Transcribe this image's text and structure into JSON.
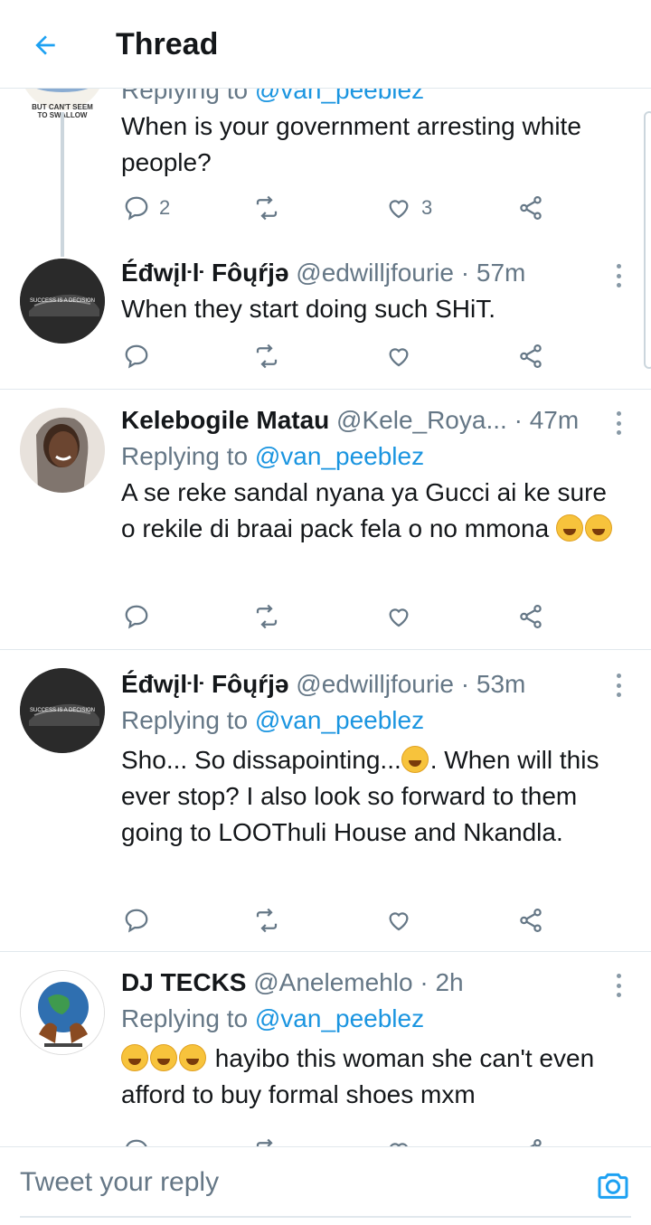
{
  "header": {
    "title": "Thread",
    "back_icon": "arrow-left-icon"
  },
  "colors": {
    "accent": "#1da1f2",
    "mention": "#1b95e0",
    "text": "#14171a",
    "muted": "#657786",
    "divider": "#e1e8ed"
  },
  "tweets": [
    {
      "name": "",
      "handle": "",
      "time": "",
      "replying_prefix": "Replying to",
      "replying_to": "@van_peeblez",
      "text": "When is your government arresting white people?",
      "avatar_caption": "BUT CAN'T SEEM TO SWALLOW",
      "replies": "2",
      "retweets": "",
      "likes": "3"
    },
    {
      "name": "Éđwįŀŀ Fôųŕjə",
      "handle": "@edwilljfourie",
      "time": "57m",
      "text": "When they start doing such SHiT.",
      "avatar_caption": "SUCCESS IS A DECISION",
      "replies": "",
      "retweets": "",
      "likes": ""
    },
    {
      "name": "Kelebogile Matau",
      "handle": "@Kele_Roya...",
      "time": "47m",
      "replying_prefix": "Replying to",
      "replying_to": "@van_peeblez",
      "text": "A se reke sandal nyana ya Gucci ai ke sure o rekile di braai pack fela o no mmona",
      "replies": "",
      "retweets": "",
      "likes": ""
    },
    {
      "name": "Éđwįŀŀ Fôųŕjə",
      "handle": "@edwilljfourie",
      "time": "53m",
      "replying_prefix": "Replying to",
      "replying_to": "@van_peeblez",
      "text_before_emoji": "Sho... So dissapointing...",
      "text_after_emoji": ". When will this ever stop? I also look so forward to them going to LOOThuli House and Nkandla.",
      "avatar_caption": "SUCCESS IS A DECISION",
      "replies": "",
      "retweets": "",
      "likes": ""
    },
    {
      "name": "DJ TECKS",
      "handle": "@Anelemehlo",
      "time": "2h",
      "replying_prefix": "Replying to",
      "replying_to": "@van_peeblez",
      "text": " hayibo this woman she can't even afford to buy formal shoes mxm",
      "replies": "",
      "retweets": "",
      "likes": ""
    }
  ],
  "reply_bar": {
    "placeholder": "Tweet your reply",
    "camera_icon": "camera-icon"
  }
}
